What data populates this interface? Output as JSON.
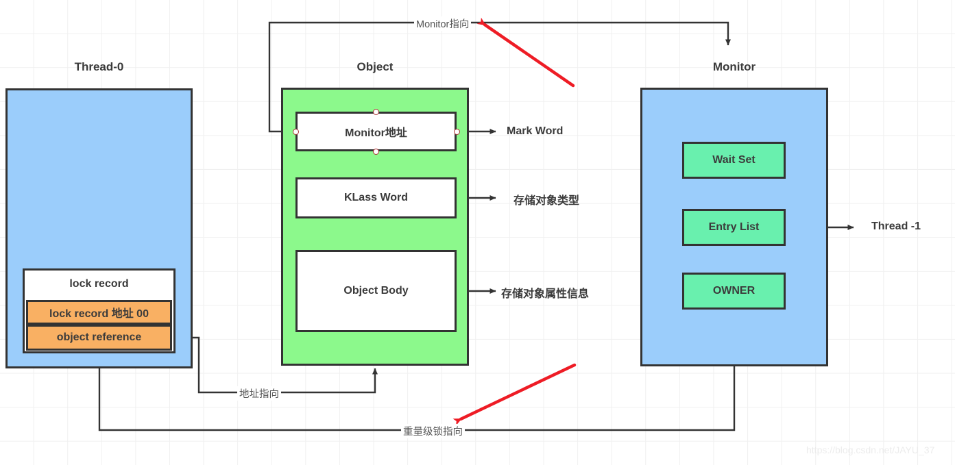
{
  "diagram": {
    "title_thread": "Thread-0",
    "title_object": "Object",
    "title_monitor": "Monitor",
    "watermark": "https://blog.csdn.net/JAYU_37"
  },
  "thread": {
    "lock_record_header": "lock record",
    "lock_record_address": "lock record 地址 00",
    "object_reference": "object reference"
  },
  "object": {
    "monitor_address": "Monitor地址",
    "klass_word": "KLass Word",
    "object_body": "Object Body",
    "mark_word_label": "Mark Word",
    "klass_word_label": "存储对象类型",
    "object_body_label": "存储对象属性信息"
  },
  "monitor": {
    "wait_set": "Wait Set",
    "entry_list": "Entry List",
    "owner": "OWNER",
    "thread_1_label": "Thread -1"
  },
  "edges": {
    "monitor_pointer": "Monitor指向",
    "address_pointer": "地址指向",
    "heavy_lock_pointer": "重量级锁指向"
  },
  "colors": {
    "blue": "#9bcdfb",
    "green": "#8cf98c",
    "mint": "#69f0ae",
    "orange": "#f9b063",
    "stroke": "#333333",
    "annotation_red": "#ee1c25"
  }
}
